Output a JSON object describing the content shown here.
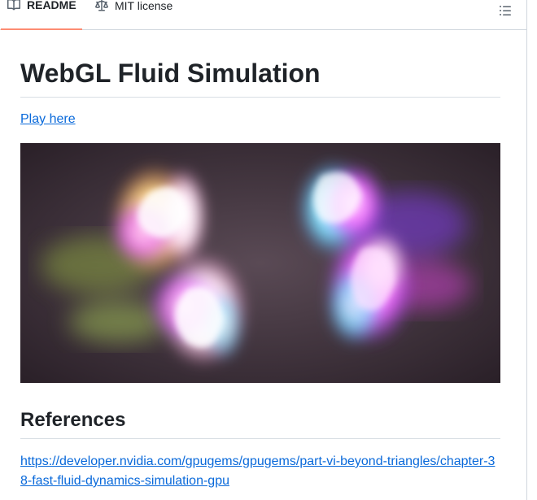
{
  "tabs": {
    "readme_label": "README",
    "license_label": "MIT license",
    "readme_icon": "book-icon",
    "license_icon": "scale-icon",
    "toc_icon": "list-unordered-icon"
  },
  "article": {
    "title": "WebGL Fluid Simulation",
    "play_link": "Play here",
    "references_heading": "References",
    "reference_link": "https://developer.nvidia.com/gpugems/gpugems/part-vi-beyond-triangles/chapter-38-fast-fluid-dynamics-simulation-gpu"
  },
  "colors": {
    "accent_tab": "#fd8c73",
    "link": "#0969da",
    "text": "#1f2328"
  }
}
